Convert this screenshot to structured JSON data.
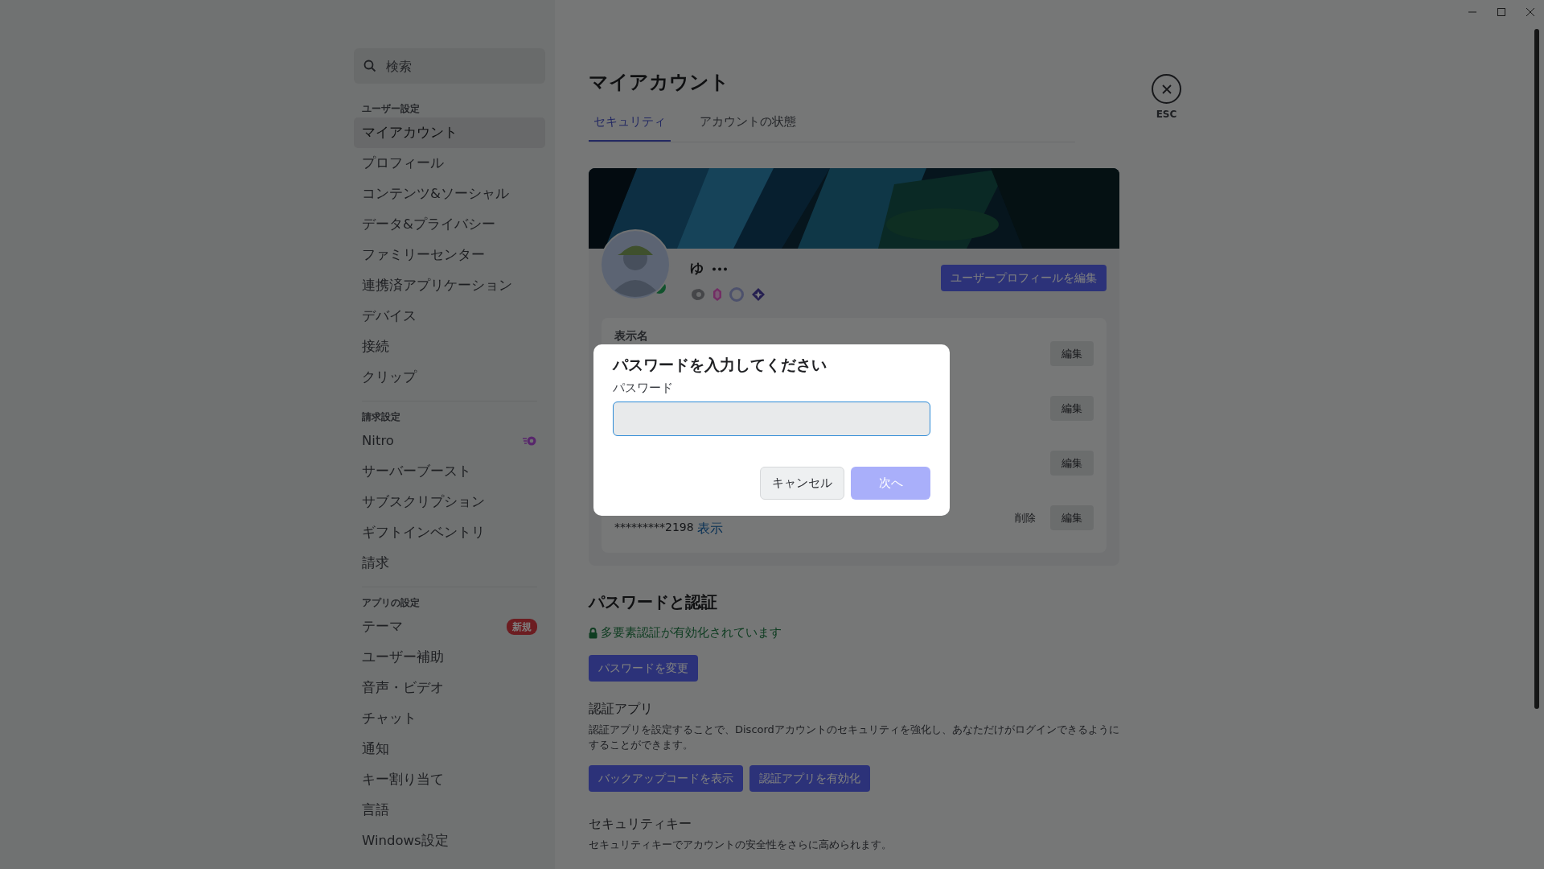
{
  "sidebar": {
    "search": {
      "placeholder": "検索"
    },
    "sections": [
      {
        "heading": "ユーザー設定",
        "items": [
          {
            "label": "マイアカウント",
            "selected": true
          },
          {
            "label": "プロフィール",
            "selected": false
          },
          {
            "label": "コンテンツ&ソーシャル",
            "selected": false
          },
          {
            "label": "データ&プライバシー",
            "selected": false
          },
          {
            "label": "ファミリーセンター",
            "selected": false
          },
          {
            "label": "連携済アプリケーション",
            "selected": false
          },
          {
            "label": "デバイス",
            "selected": false
          },
          {
            "label": "接続",
            "selected": false
          },
          {
            "label": "クリップ",
            "selected": false
          }
        ]
      },
      {
        "heading": "請求設定",
        "items": [
          {
            "label": "Nitro",
            "selected": false,
            "kind": "nitro"
          },
          {
            "label": "サーバーブースト",
            "selected": false
          },
          {
            "label": "サブスクリプション",
            "selected": false
          },
          {
            "label": "ギフトインベントリ",
            "selected": false
          },
          {
            "label": "請求",
            "selected": false
          }
        ]
      },
      {
        "heading": "アプリの設定",
        "items": [
          {
            "label": "テーマ",
            "selected": false,
            "badge": "新規"
          },
          {
            "label": "ユーザー補助",
            "selected": false
          },
          {
            "label": "音声・ビデオ",
            "selected": false
          },
          {
            "label": "チャット",
            "selected": false
          },
          {
            "label": "通知",
            "selected": false
          },
          {
            "label": "キー割り当て",
            "selected": false
          },
          {
            "label": "言語",
            "selected": false
          },
          {
            "label": "Windows設定",
            "selected": false
          }
        ]
      }
    ]
  },
  "page": {
    "title": "マイアカウント",
    "tabs": [
      {
        "label": "セキュリティ",
        "selected": true
      },
      {
        "label": "アカウントの状態",
        "selected": false
      }
    ],
    "profile": {
      "username": "ゆ",
      "edit_button": "ユーザープロフィールを編集",
      "fields": [
        {
          "label": "表示名",
          "action": "編集"
        },
        {
          "action": "編集"
        },
        {
          "action": "編集"
        },
        {
          "value": "*********2198",
          "reveal": "表示",
          "remove": "削除",
          "action": "編集"
        }
      ]
    },
    "password_section": {
      "title": "パスワードと認証",
      "mfa_status": "多要素認証が有効化されています",
      "change_button": "パスワードを変更",
      "auth_app": {
        "title": "認証アプリ",
        "description": "認証アプリを設定することで、Discordアカウントのセキュリティを強化し、あなただけがログインできるようにすることができます。",
        "buttons": [
          "バックアップコードを表示",
          "認証アプリを有効化"
        ]
      },
      "security_key": {
        "title": "セキュリティキー",
        "description": "セキュリティキーでアカウントの安全性をさらに高められます。"
      }
    }
  },
  "close": {
    "label": "ESC"
  },
  "modal": {
    "title": "パスワードを入力してください",
    "field_label": "パスワード",
    "cancel": "キャンセル",
    "next": {
      "label": "次へ",
      "disabled": true
    }
  }
}
